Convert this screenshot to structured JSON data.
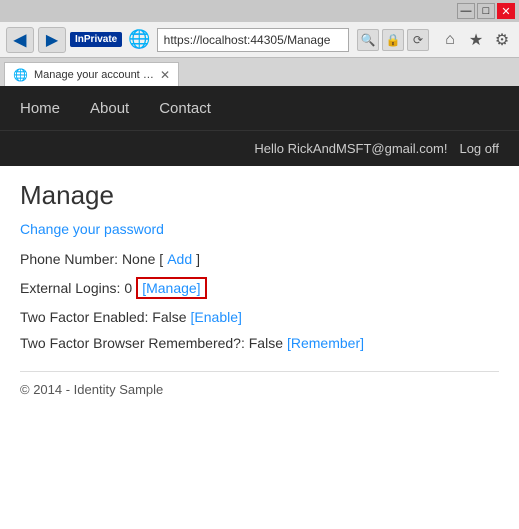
{
  "titlebar": {
    "minimize": "—",
    "maximize": "□",
    "close": "✕"
  },
  "addressbar": {
    "back_arrow": "◀",
    "forward_arrow": "▶",
    "inprivate": "InPrivate",
    "url": "https://localhost:44305/Manage",
    "search_icon": "🔍",
    "lock_icon": "🔒",
    "refresh_icon": "⟳",
    "home_icon": "⌂",
    "star_icon": "★",
    "gear_icon": "⚙"
  },
  "tab": {
    "title": "Manage your account - Ide...",
    "close": "✕"
  },
  "nav": {
    "links": [
      {
        "label": "Home"
      },
      {
        "label": "About"
      },
      {
        "label": "Contact"
      }
    ]
  },
  "userbar": {
    "greeting": "Hello RickAndMSFT@gmail.com!",
    "logoff": "Log off"
  },
  "page": {
    "title": "Manage",
    "change_password": "Change your password",
    "phone_label": "Phone Number: None [",
    "phone_add": "Add",
    "phone_end": "]",
    "external_label": "External Logins:",
    "external_count": "0",
    "external_manage": "[Manage]",
    "twofactor_label": "Two Factor Enabled: False",
    "twofactor_enable": "[Enable]",
    "twofactor_browser_label": "Two Factor Browser Remembered?: False",
    "twofactor_remember": "[Remember]",
    "footer": "© 2014 - Identity Sample"
  }
}
